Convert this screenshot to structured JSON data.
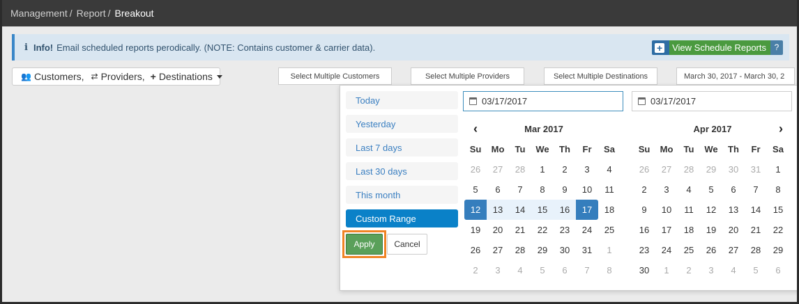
{
  "breadcrumb": {
    "items": [
      "Management",
      "Report"
    ],
    "separator": "/",
    "current": "Breakout"
  },
  "info": {
    "icon": "info-icon",
    "strong": "Info!",
    "text": "Email scheduled reports perodically. (NOTE: Contains customer & carrier data).",
    "button_label": "View Schedule Reports",
    "help_label": "?"
  },
  "filter": {
    "customers": "Customers,",
    "providers": "Providers,",
    "destinations": "Destinations"
  },
  "selects": {
    "customers": "Select Multiple Customers",
    "providers": "Select Multiple Providers",
    "destinations": "Select Multiple Destinations"
  },
  "daterange": "March 30, 2017 - March 30, 2",
  "picker": {
    "ranges": [
      "Today",
      "Yesterday",
      "Last 7 days",
      "Last 30 days",
      "This month",
      "Custom Range"
    ],
    "active_range": "Custom Range",
    "apply": "Apply",
    "cancel": "Cancel",
    "weekdays": [
      "Su",
      "Mo",
      "Tu",
      "We",
      "Th",
      "Fr",
      "Sa"
    ],
    "left": {
      "input": "03/17/2017",
      "month": "Mar 2017",
      "weeks": [
        [
          "26",
          "27",
          "28",
          "1",
          "2",
          "3",
          "4"
        ],
        [
          "5",
          "6",
          "7",
          "8",
          "9",
          "10",
          "11"
        ],
        [
          "12",
          "13",
          "14",
          "15",
          "16",
          "17",
          "18"
        ],
        [
          "19",
          "20",
          "21",
          "22",
          "23",
          "24",
          "25"
        ],
        [
          "26",
          "27",
          "28",
          "29",
          "30",
          "31",
          "1"
        ],
        [
          "2",
          "3",
          "4",
          "5",
          "6",
          "7",
          "8"
        ]
      ],
      "off_first_row": 3,
      "off_from_index_last": 34
    },
    "right": {
      "input": "03/17/2017",
      "month": "Apr 2017",
      "weeks": [
        [
          "26",
          "27",
          "28",
          "29",
          "30",
          "31",
          "1"
        ],
        [
          "2",
          "3",
          "4",
          "5",
          "6",
          "7",
          "8"
        ],
        [
          "9",
          "10",
          "11",
          "12",
          "13",
          "14",
          "15"
        ],
        [
          "16",
          "17",
          "18",
          "19",
          "20",
          "21",
          "22"
        ],
        [
          "23",
          "24",
          "25",
          "26",
          "27",
          "28",
          "29"
        ],
        [
          "30",
          "1",
          "2",
          "3",
          "4",
          "5",
          "6"
        ]
      ],
      "off_first_row": 6,
      "off_from_index_last": 36
    },
    "selection": {
      "start_day": "12",
      "end_day": "17",
      "month": "Mar 2017"
    }
  },
  "colors": {
    "accent": "#357ebd",
    "apply_highlight": "#f08324",
    "custom_range": "#0a81c8"
  }
}
